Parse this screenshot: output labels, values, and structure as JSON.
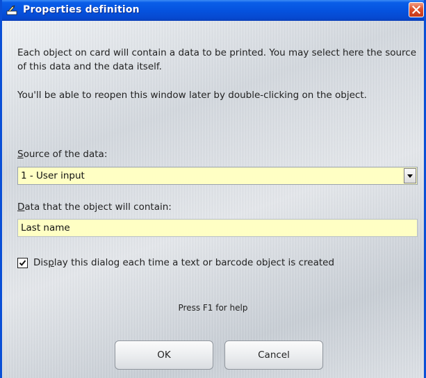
{
  "window": {
    "title": "Properties definition",
    "icon": "properties-definition-icon",
    "close_icon": "close-icon"
  },
  "description": {
    "paragraph1": "Each object on card will contain a data to be printed. You may select here the source of this data and the data itself.",
    "paragraph2": "You'll be able to reopen this window later by double-clicking on the object."
  },
  "source": {
    "label_accel": "S",
    "label_rest": "ource of the data:",
    "selected_value": "1 - User input",
    "dropdown_icon": "chevron-down-icon"
  },
  "data_field": {
    "label_accel": "D",
    "label_rest": "ata that the object will contain:",
    "value": "Last name"
  },
  "display_dialog": {
    "checked": true,
    "label_before": "Dis",
    "label_accel": "p",
    "label_after": "lay this dialog each time a text or barcode object is created"
  },
  "help_text": "Press F1 for help",
  "buttons": {
    "ok": "OK",
    "cancel": "Cancel"
  },
  "colors": {
    "titlebar": "#0553df",
    "field_background": "#ffffc4",
    "close_button": "#e0512c"
  }
}
